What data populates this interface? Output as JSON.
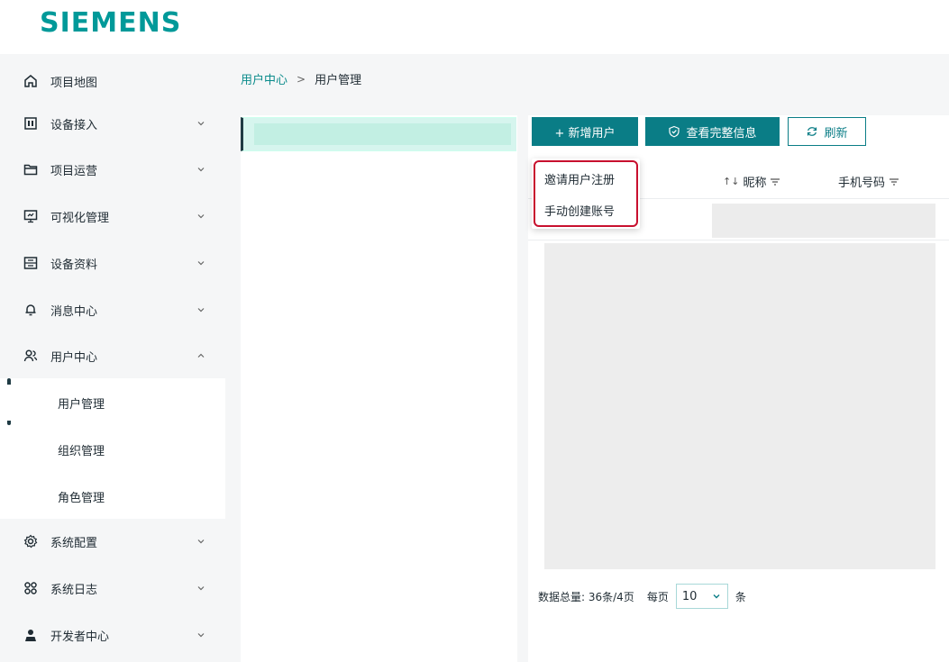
{
  "brand": {
    "logo": "SIEMENS"
  },
  "sidebar": {
    "items": [
      {
        "label": "项目地图",
        "icon": "home-icon",
        "has_chevron": false
      },
      {
        "label": "设备接入",
        "icon": "device-access-icon",
        "has_chevron": true,
        "chevron": "down"
      },
      {
        "label": "项目运营",
        "icon": "folder-icon",
        "has_chevron": true,
        "chevron": "down"
      },
      {
        "label": "可视化管理",
        "icon": "monitor-icon",
        "has_chevron": true,
        "chevron": "down"
      },
      {
        "label": "设备资料",
        "icon": "archive-icon",
        "has_chevron": true,
        "chevron": "down"
      },
      {
        "label": "消息中心",
        "icon": "bell-icon",
        "has_chevron": true,
        "chevron": "down"
      },
      {
        "label": "用户中心",
        "icon": "users-icon",
        "has_chevron": true,
        "chevron": "up",
        "expanded": true
      },
      {
        "label": "用户管理",
        "sub": true,
        "active": true
      },
      {
        "label": "组织管理",
        "sub": true
      },
      {
        "label": "角色管理",
        "sub": true
      },
      {
        "label": "系统配置",
        "icon": "gear-icon",
        "has_chevron": true,
        "chevron": "down"
      },
      {
        "label": "系统日志",
        "icon": "grid-icon",
        "has_chevron": true,
        "chevron": "down"
      },
      {
        "label": "开发者中心",
        "icon": "developer-icon",
        "has_chevron": true,
        "chevron": "down"
      }
    ]
  },
  "breadcrumb": {
    "parent": "用户中心",
    "separator": ">",
    "current": "用户管理"
  },
  "toolbar": {
    "add_user": "+ 新增用户",
    "view_full_info": "查看完整信息",
    "refresh": "刷新"
  },
  "dropdown": {
    "items": [
      "邀请用户注册",
      "手动创建账号"
    ]
  },
  "table": {
    "columns": [
      {
        "label": "昵称",
        "sortable": true,
        "filterable": true
      },
      {
        "label": "手机号码",
        "sortable": false,
        "filterable": true
      }
    ]
  },
  "pagination": {
    "total_text": "数据总量: 36条/4页",
    "per_page_label": "每页",
    "per_page_value": "10",
    "unit": "条"
  },
  "colors": {
    "brand": "#009999",
    "primary": "#0a7d86",
    "highlight": "#c8102e",
    "sidebar_bg": "#f5f6f7"
  }
}
